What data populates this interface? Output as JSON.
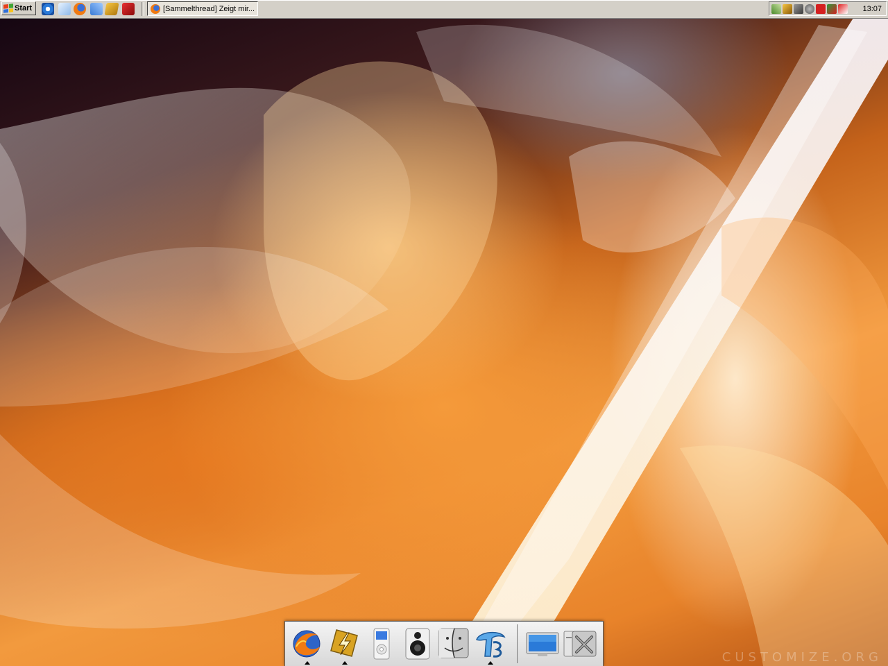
{
  "taskbar": {
    "start_label": "Start",
    "quick_launch": [
      "internet-explorer-icon",
      "mail-icon",
      "firefox-icon",
      "network-icon",
      "winamp-icon",
      "acrobat-icon"
    ],
    "task": {
      "label": "[Sammelthread] Zeigt mir...",
      "icon": "firefox-icon"
    },
    "tray_icons": [
      "network-tray-icon",
      "winamp-tray-icon",
      "settings-tray-icon",
      "messenger-tray-icon",
      "ati-tray-icon",
      "volume-tray-icon",
      "antivirus-tray-icon"
    ],
    "clock": "13:07"
  },
  "dock": {
    "items": [
      {
        "name": "firefox",
        "running": true
      },
      {
        "name": "winamp",
        "running": true
      },
      {
        "name": "ipod",
        "running": false
      },
      {
        "name": "speaker",
        "running": false
      },
      {
        "name": "finder",
        "running": false
      },
      {
        "name": "trillian",
        "running": true
      },
      {
        "name": "my-computer",
        "running": false
      },
      {
        "name": "system-tools",
        "running": false
      }
    ]
  },
  "wallpaper": {
    "watermark": "CUSTOMIZE.ORG"
  }
}
